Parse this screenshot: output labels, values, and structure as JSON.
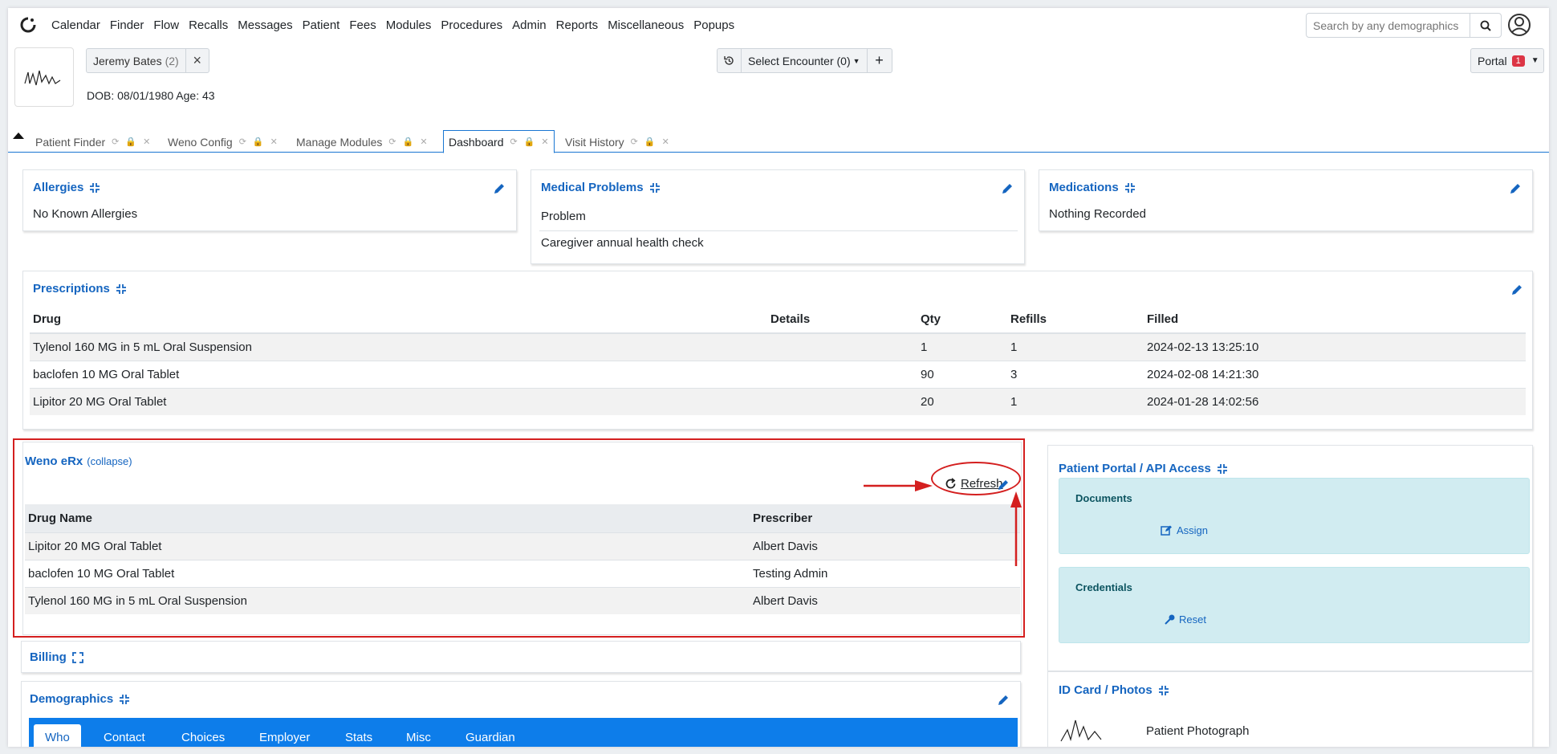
{
  "nav": {
    "menu": [
      "Calendar",
      "Finder",
      "Flow",
      "Recalls",
      "Messages",
      "Patient",
      "Fees",
      "Modules",
      "Procedures",
      "Admin",
      "Reports",
      "Miscellaneous",
      "Popups"
    ],
    "search_placeholder": "Search by any demographics"
  },
  "patient": {
    "name": "Jeremy Bates",
    "count": "(2)",
    "dob_line": "DOB: 08/01/1980 Age: 43"
  },
  "encounter": {
    "label": "Select Encounter",
    "count": "(0)"
  },
  "portal": {
    "label": "Portal",
    "badge": "1"
  },
  "tabs": [
    "Patient Finder",
    "Weno Config",
    "Manage Modules",
    "Dashboard",
    "Visit History"
  ],
  "allergies": {
    "title": "Allergies",
    "text": "No Known Allergies"
  },
  "medical_problems": {
    "title": "Medical Problems",
    "header": "Problem",
    "items": [
      "Caregiver annual health check"
    ]
  },
  "medications": {
    "title": "Medications",
    "text": "Nothing Recorded"
  },
  "prescriptions": {
    "title": "Prescriptions",
    "columns": [
      "Drug",
      "Details",
      "Qty",
      "Refills",
      "Filled"
    ],
    "rows": [
      [
        "Tylenol 160 MG in 5 mL Oral Suspension",
        "",
        "1",
        "1",
        "2024-02-13 13:25:10"
      ],
      [
        "baclofen 10 MG Oral Tablet",
        "",
        "90",
        "3",
        "2024-02-08 14:21:30"
      ],
      [
        "Lipitor 20 MG Oral Tablet",
        "",
        "20",
        "1",
        "2024-01-28 14:02:56"
      ]
    ]
  },
  "weno": {
    "title": "Weno eRx",
    "collapse": "(collapse)",
    "refresh": "Refresh",
    "columns": [
      "Drug Name",
      "Prescriber"
    ],
    "rows": [
      [
        "Lipitor 20 MG Oral Tablet",
        "Albert Davis"
      ],
      [
        "baclofen 10 MG Oral Tablet",
        "Testing Admin"
      ],
      [
        "Tylenol 160 MG in 5 mL Oral Suspension",
        "Albert Davis"
      ]
    ]
  },
  "billing": {
    "title": "Billing"
  },
  "patient_portal": {
    "title": "Patient Portal / API Access",
    "documents": "Documents",
    "assign": "Assign",
    "credentials": "Credentials",
    "reset": "Reset"
  },
  "demographics": {
    "title": "Demographics",
    "tabs": [
      "Who",
      "Contact",
      "Choices",
      "Employer",
      "Stats",
      "Misc",
      "Guardian"
    ]
  },
  "id_card": {
    "title": "ID Card / Photos",
    "photo_label": "Patient Photograph"
  },
  "colors": {
    "link": "#1565c0",
    "annotation": "#d41f1f",
    "active_tab": "#0d7dea",
    "info_box": "#d1ecf1"
  }
}
